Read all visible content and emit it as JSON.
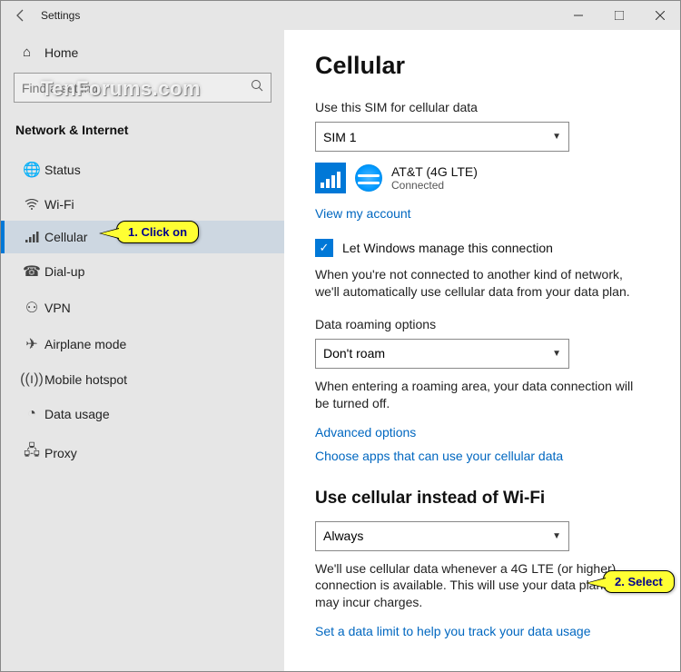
{
  "titlebar": {
    "title": "Settings"
  },
  "watermark": "TenForums.com",
  "sidebar": {
    "home": "Home",
    "search_placeholder": "Find a setting",
    "section": "Network & Internet",
    "items": [
      {
        "id": "status",
        "label": "Status"
      },
      {
        "id": "wifi",
        "label": "Wi-Fi"
      },
      {
        "id": "cellular",
        "label": "Cellular",
        "active": true
      },
      {
        "id": "dialup",
        "label": "Dial-up"
      },
      {
        "id": "vpn",
        "label": "VPN"
      },
      {
        "id": "airplane",
        "label": "Airplane mode"
      },
      {
        "id": "hotspot",
        "label": "Mobile hotspot"
      },
      {
        "id": "datausage",
        "label": "Data usage"
      },
      {
        "id": "proxy",
        "label": "Proxy"
      }
    ]
  },
  "content": {
    "heading": "Cellular",
    "sim_label": "Use this SIM for cellular data",
    "sim_value": "SIM 1",
    "network_name": "AT&T (4G LTE)",
    "network_status": "Connected",
    "view_account": "View my account",
    "manage_conn": "Let Windows manage this connection",
    "manage_desc": "When you're not connected to another kind of network, we'll automatically use cellular data from your data plan.",
    "roaming_label": "Data roaming options",
    "roaming_value": "Don't roam",
    "roaming_desc": "When entering a roaming area, your data connection will be turned off.",
    "adv_options": "Advanced options",
    "choose_apps": "Choose apps that can use your cellular data",
    "section2": "Use cellular instead of Wi-Fi",
    "instead_value": "Always",
    "instead_desc": "We'll use cellular data whenever a 4G LTE (or higher) connection is available. This will use your data plan and may incur charges.",
    "data_limit": "Set a data limit to help you track your data usage"
  },
  "callouts": {
    "c1": "1. Click on",
    "c2": "2. Select"
  }
}
